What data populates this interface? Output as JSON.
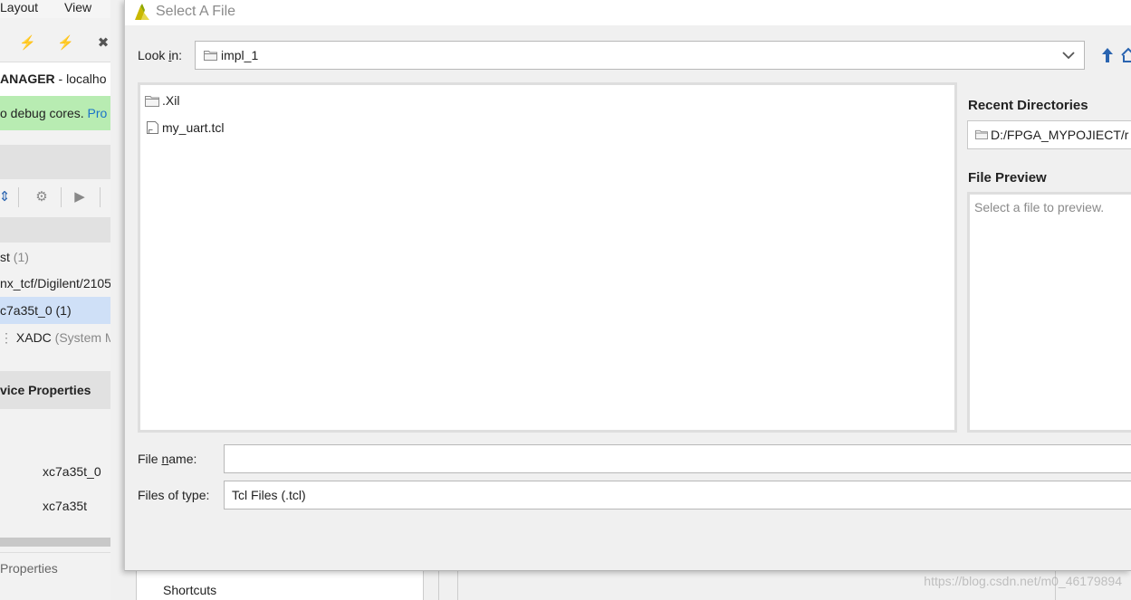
{
  "background_app": {
    "menu": [
      "Layout",
      "View"
    ],
    "manager_title_bold": "ANAGER",
    "manager_title_rest": " - localho",
    "banner_text": "o debug cores.",
    "banner_link": "Pro",
    "tree": [
      {
        "text": "st",
        "muted": " (1)"
      },
      {
        "text": "nx_tcf/Digilent/2105",
        "muted": ""
      },
      {
        "text": "c7a35t_0 (1)",
        "muted": ""
      },
      {
        "text": "XADC",
        "muted": " (System M"
      }
    ],
    "section_title": "vice Properties",
    "prop_values": [
      "xc7a35t_0",
      "xc7a35t"
    ],
    "tab_label": "Properties",
    "shortcuts_label": "Shortcuts",
    "watermark": "https://blog.csdn.net/m0_46179894"
  },
  "dialog": {
    "title": "Select A File",
    "look_in_label_pre": "Look ",
    "look_in_label_u": "i",
    "look_in_label_post": "n:",
    "look_in_value": "impl_1",
    "files": [
      {
        "name": ".Xil",
        "type": "folder"
      },
      {
        "name": "my_uart.tcl",
        "type": "file"
      }
    ],
    "recent_title": "Recent Directories",
    "recent_value": "D:/FPGA_MYPOJIECT/r",
    "preview_title": "File Preview",
    "preview_placeholder": "Select a file to preview.",
    "file_name_label_pre": "File ",
    "file_name_label_u": "n",
    "file_name_label_post": "ame:",
    "file_name_value": "",
    "file_type_label": "Files of type:",
    "file_type_value": "Tcl Files (.tcl)"
  },
  "colors": {
    "banner": "#b8ecb2",
    "selected_row": "#cfe0f7",
    "nav_up": "#2a64b0",
    "logo": "#c9b800"
  }
}
